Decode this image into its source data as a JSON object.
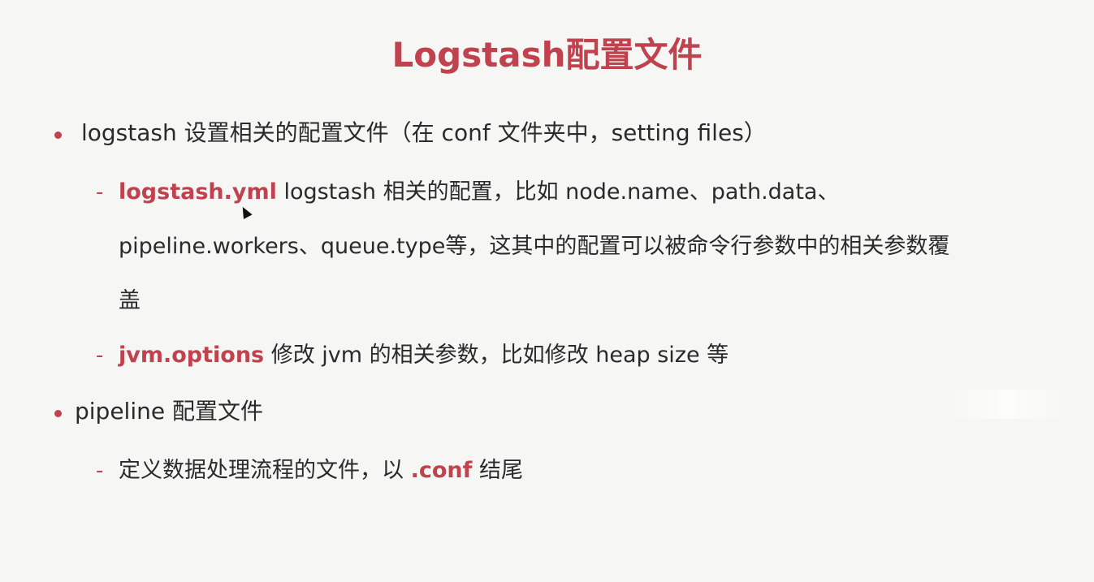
{
  "slide": {
    "title": "Logstash配置文件",
    "items": [
      {
        "text": "logstash 设置相关的配置文件（在 conf 文件夹中，setting files）",
        "subitems": [
          {
            "highlight": "logstash.yml",
            "text_line1": " logstash 相关的配置，比如 node.name、path.data、",
            "text_line2": "pipeline.workers、queue.type等，这其中的配置可以被命令行参数中的相关参数覆",
            "text_line3": "盖"
          },
          {
            "highlight": "jvm.options",
            "text": " 修改 jvm 的相关参数，比如修改 heap size 等"
          }
        ]
      },
      {
        "text": "pipeline 配置文件",
        "subitems": [
          {
            "prefix": "定义数据处理流程的文件，以 ",
            "highlight": ".conf",
            "suffix": " 结尾"
          }
        ]
      }
    ],
    "dash": "-",
    "accent_color": "#c1424f",
    "text_color": "#2a2a2a",
    "background_color": "#f6f6f4"
  }
}
